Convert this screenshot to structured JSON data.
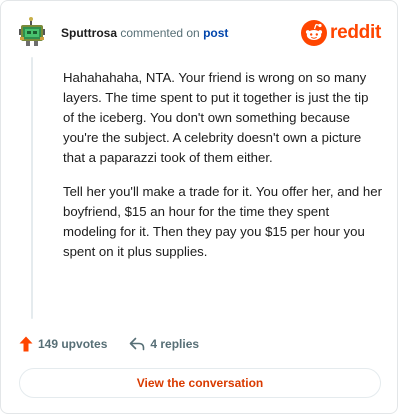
{
  "header": {
    "username": "Sputtrosa",
    "action_text": " commented on ",
    "post_link": "post",
    "brand": "reddit"
  },
  "comment": {
    "paragraphs": [
      "Hahahahaha, NTA. Your friend is wrong on so many layers. The time spent to put it together is just the tip of the iceberg. You don't own something because you're the subject. A celebrity doesn't own a picture that a paparazzi took of them either.",
      "Tell her you'll make a trade for it. You offer her, and her boyfriend, $15 an hour for the time they spent modeling for it. Then they pay you $15 per hour you spent on it plus supplies."
    ]
  },
  "actions": {
    "upvotes": "149 upvotes",
    "replies": "4 replies"
  },
  "cta": {
    "label": "View the conversation"
  },
  "colors": {
    "brand": "#ff4500",
    "link": "#0045ac",
    "cta_text": "#d93a00",
    "muted": "#576f76"
  },
  "icons": {
    "avatar": "snoo-avatar",
    "brand": "reddit-logo-icon",
    "upvote": "upvote-arrow-icon",
    "reply": "reply-arrow-icon"
  }
}
